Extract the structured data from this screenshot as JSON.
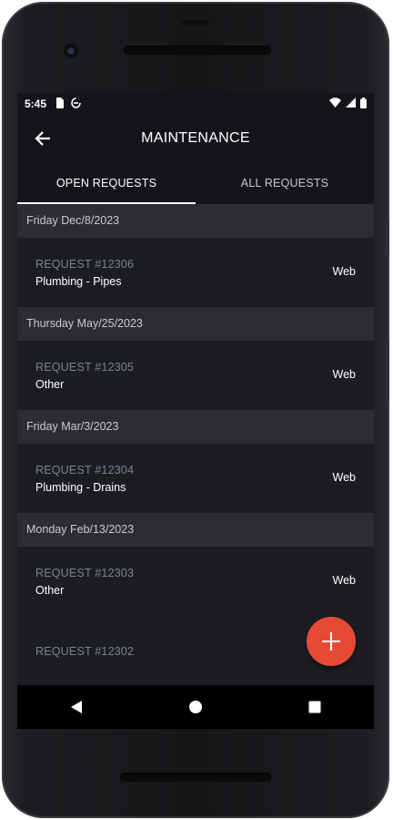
{
  "status_bar": {
    "time": "5:45"
  },
  "app_bar": {
    "title": "MAINTENANCE"
  },
  "tabs": [
    {
      "label": "OPEN REQUESTS",
      "active": true
    },
    {
      "label": "ALL REQUESTS",
      "active": false
    }
  ],
  "groups": [
    {
      "date": "Friday Dec/8/2023",
      "requests": [
        {
          "number": "REQUEST #12306",
          "description": "Plumbing - Pipes",
          "source": "Web"
        }
      ]
    },
    {
      "date": "Thursday May/25/2023",
      "requests": [
        {
          "number": "REQUEST #12305",
          "description": "Other",
          "source": "Web"
        }
      ]
    },
    {
      "date": "Friday Mar/3/2023",
      "requests": [
        {
          "number": "REQUEST #12304",
          "description": "Plumbing - Drains",
          "source": "Web"
        }
      ]
    },
    {
      "date": "Monday Feb/13/2023",
      "requests": [
        {
          "number": "REQUEST #12303",
          "description": "Other",
          "source": "Web"
        },
        {
          "number": "REQUEST #12302",
          "description": "",
          "source": ""
        }
      ]
    }
  ],
  "colors": {
    "accent_fab": "#e64a35",
    "background": "#1b1c1f",
    "section_header": "#2b2d32",
    "muted_text": "#7b8196"
  },
  "icons": {
    "back": "arrow-left-icon",
    "fab": "plus-icon",
    "nav_back": "triangle-back-icon",
    "nav_home": "circle-home-icon",
    "nav_recents": "square-recents-icon"
  }
}
